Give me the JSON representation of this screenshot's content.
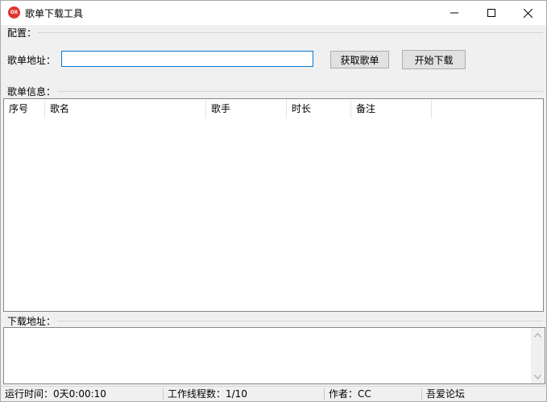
{
  "window": {
    "title": "歌单下载工具",
    "icon": "app-logo-icon",
    "icon_text": "OX",
    "controls": [
      "minimize-icon",
      "maximize-icon",
      "close-icon"
    ]
  },
  "config": {
    "group_label": "配置：",
    "url_label": "歌单地址：",
    "url_value": "",
    "fetch_button": "获取歌单",
    "start_button": "开始下载"
  },
  "playlist": {
    "group_label": "歌单信息：",
    "columns": [
      "序号",
      "歌名",
      "歌手",
      "时长",
      "备注"
    ],
    "rows": []
  },
  "download": {
    "group_label": "下载地址：",
    "value": ""
  },
  "status": {
    "runtime": "运行时间：0天0:00:10",
    "threads": "工作线程数：1/10",
    "author": "作者：CC",
    "forum": "吾爱论坛"
  },
  "colors": {
    "accent": "#0078d7",
    "close_icon_bg": "#e0342f"
  }
}
